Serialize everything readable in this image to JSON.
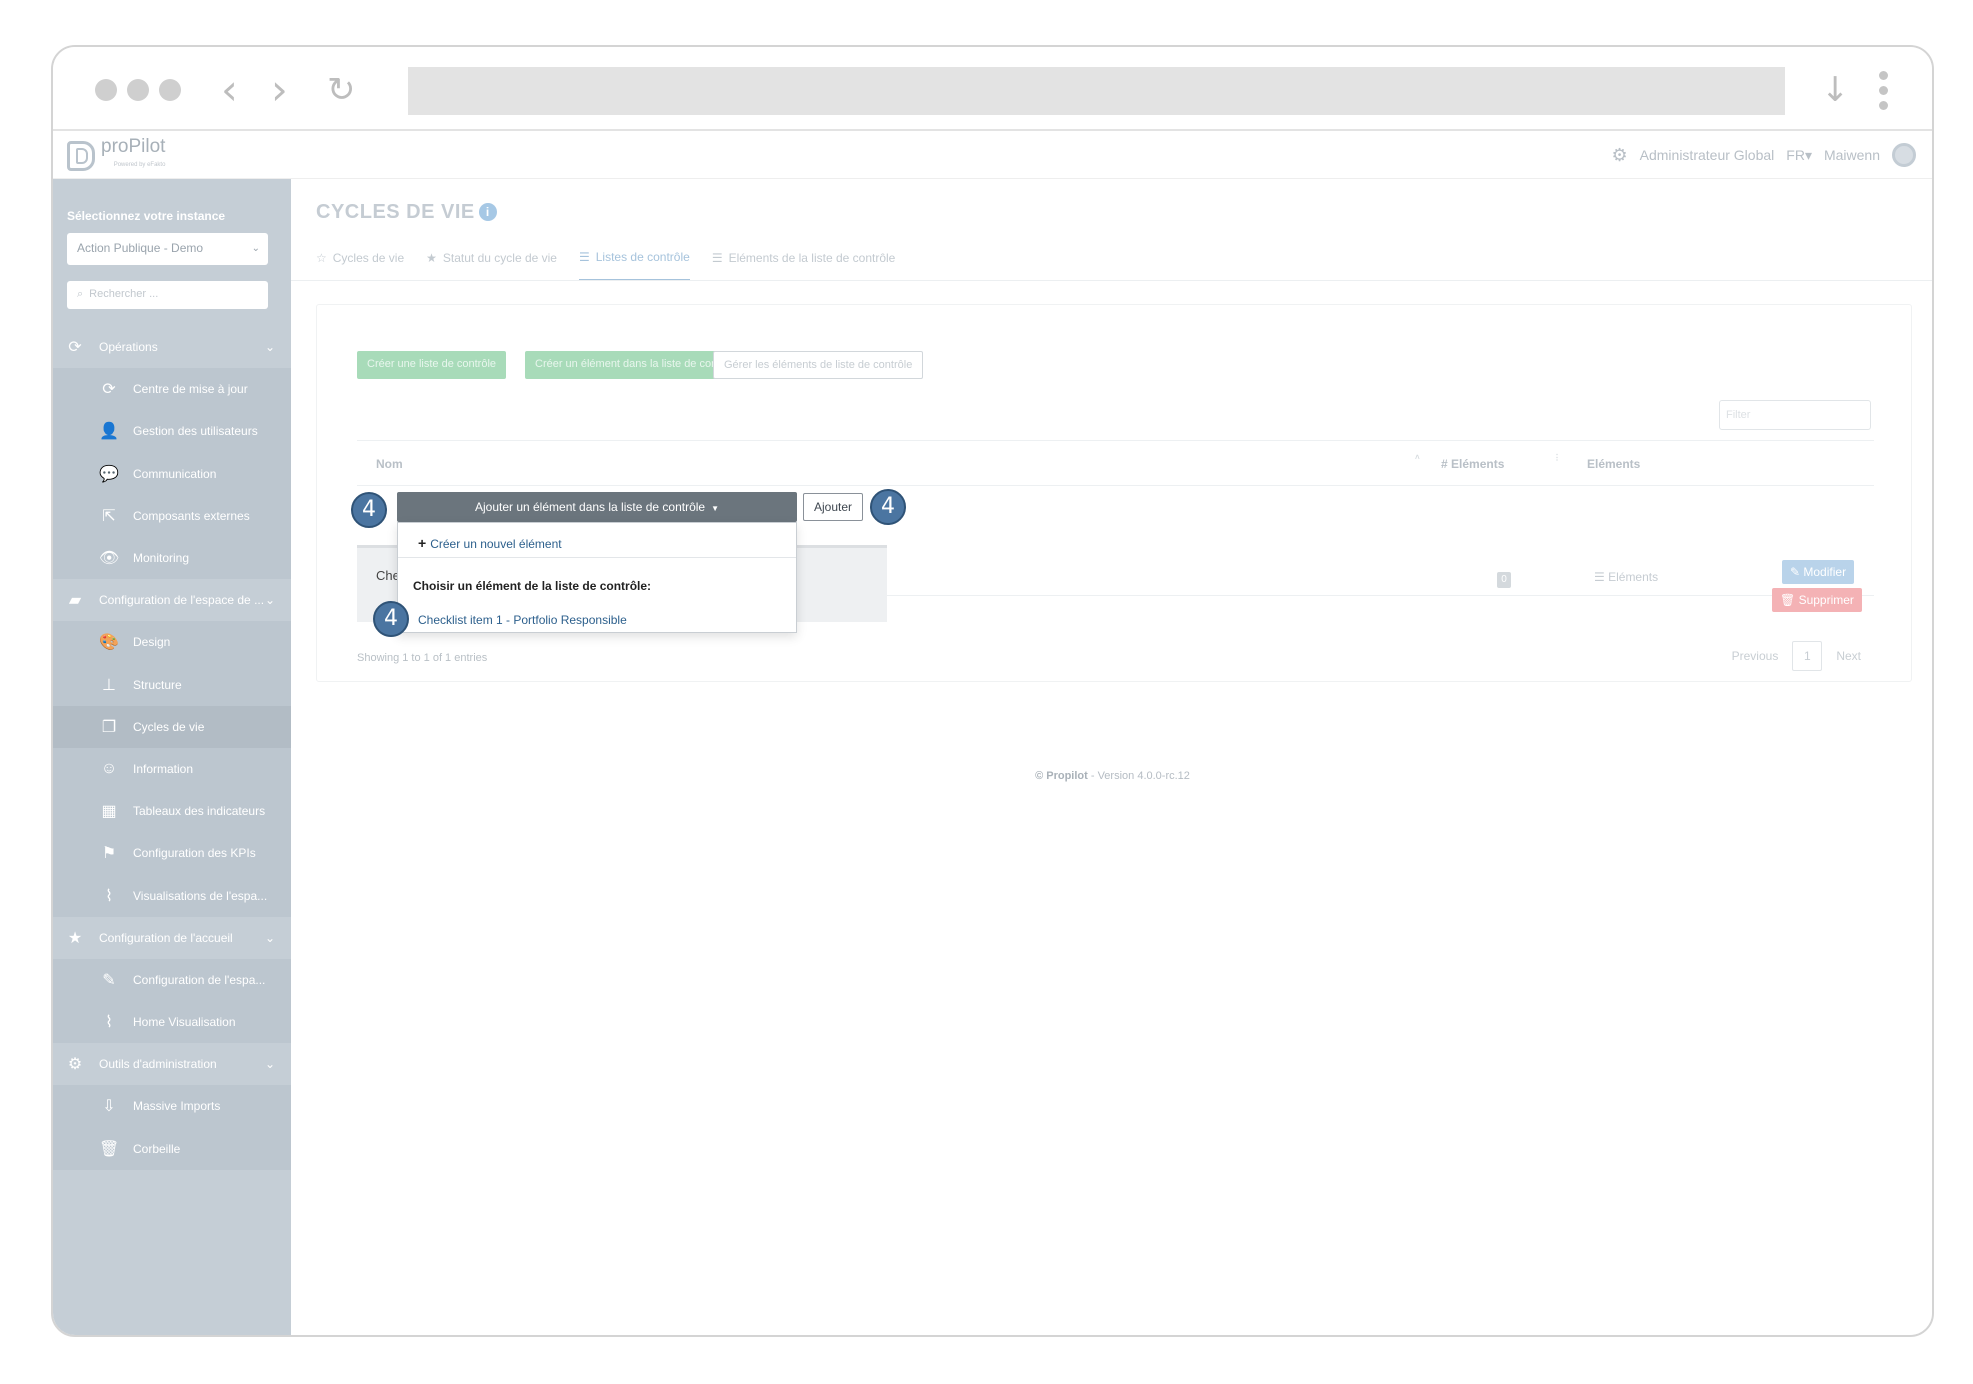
{
  "app": {
    "logo_text": "proPilot",
    "logo_sub": "Powered by eFakto",
    "user_role": "Administrateur Global",
    "language": "FR",
    "user_name": "Maiwenn"
  },
  "sidebar": {
    "instance_label": "Sélectionnez votre instance",
    "instance_value": "Action Publique - Demo",
    "search_placeholder": "Rechercher ...",
    "items": [
      {
        "label": "Opérations",
        "icon": "refresh-icon",
        "level": "top"
      },
      {
        "label": "Centre de mise à jour",
        "icon": "refresh-icon",
        "level": "sub"
      },
      {
        "label": "Gestion des utilisateurs",
        "icon": "user-icon",
        "level": "sub"
      },
      {
        "label": "Communication",
        "icon": "chat-icon",
        "level": "sub"
      },
      {
        "label": "Composants externes",
        "icon": "share-icon",
        "level": "sub"
      },
      {
        "label": "Monitoring",
        "icon": "eye-icon",
        "level": "sub"
      },
      {
        "label": "Configuration de l'espace de ...",
        "icon": "folder-icon",
        "level": "top"
      },
      {
        "label": "Design",
        "icon": "palette-icon",
        "level": "sub"
      },
      {
        "label": "Structure",
        "icon": "sitemap-icon",
        "level": "sub"
      },
      {
        "label": "Cycles de vie",
        "icon": "copy-icon",
        "level": "sub",
        "active": true
      },
      {
        "label": "Information",
        "icon": "comment-icon",
        "level": "sub"
      },
      {
        "label": "Tableaux des indicateurs",
        "icon": "table-icon",
        "level": "sub"
      },
      {
        "label": "Configuration des KPIs",
        "icon": "flag-icon",
        "level": "sub"
      },
      {
        "label": "Visualisations de l'espa...",
        "icon": "chart-icon",
        "level": "sub"
      },
      {
        "label": "Configuration de l'accueil",
        "icon": "star-icon",
        "level": "top"
      },
      {
        "label": "Configuration de l'espa...",
        "icon": "edit-icon",
        "level": "sub"
      },
      {
        "label": "Home Visualisation",
        "icon": "chart-icon",
        "level": "sub"
      },
      {
        "label": "Outils d'administration",
        "icon": "gear-icon",
        "level": "top"
      },
      {
        "label": "Massive Imports",
        "icon": "download-icon",
        "level": "sub"
      },
      {
        "label": "Corbeille",
        "icon": "trash-icon",
        "level": "sub"
      }
    ]
  },
  "main": {
    "page_title": "CYCLES DE VIE",
    "tabs": [
      {
        "label": "Cycles de vie",
        "icon": "star-outline-icon"
      },
      {
        "label": "Statut du cycle de vie",
        "icon": "star-icon"
      },
      {
        "label": "Listes de contrôle",
        "icon": "list-icon",
        "active": true
      },
      {
        "label": "Eléments de la liste de contrôle",
        "icon": "list-icon"
      }
    ],
    "buttons": {
      "create_list": "Créer une liste de contrôle",
      "create_element": "Créer un élément dans la liste de contrôle",
      "manage_elements": "Gérer les éléments de liste de contrôle"
    },
    "filter_placeholder": "Filter",
    "table": {
      "columns": [
        "Nom",
        "# Eléments",
        "Eléments"
      ],
      "rows": [
        {
          "name": "Che",
          "count": "0",
          "elements_link": "Eléments",
          "edit": "Modifier",
          "delete": "Supprimer"
        }
      ]
    },
    "entries_info": "Showing 1 to 1 of 1 entries",
    "pagination": {
      "previous": "Previous",
      "page": "1",
      "next": "Next"
    },
    "footer_brand": "© Propilot",
    "footer_version": "- Version 4.0.0-rc.12"
  },
  "dropdown": {
    "toggle_label": "Ajouter un élément dans la liste de contrôle",
    "add_button": "Ajouter",
    "create_new": "Créer un nouvel élément",
    "header": "Choisir un élément de la liste de contrôle:",
    "items": [
      "Checklist item 1 - Portfolio Responsible"
    ]
  },
  "step_badges": [
    "4",
    "4",
    "4"
  ]
}
